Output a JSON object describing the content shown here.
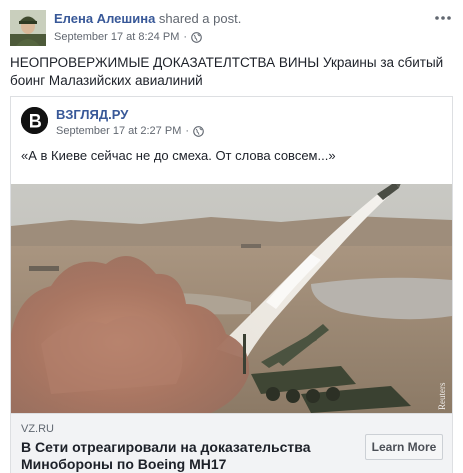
{
  "post": {
    "author_name": "Елена Алешина",
    "action_text": "shared a post.",
    "timestamp": "September 17 at 8:24 PM",
    "separator": "·",
    "privacy_icon": "globe-icon",
    "more_icon": "more-options-icon",
    "text_caps": "НЕОПРОВЕРЖИМЫЕ ДОКАЗАТЕЛТСТВА ВИНЫ",
    "text_rest": " Украины за сбитый боинг Малазийских авиалиний"
  },
  "shared": {
    "page_name": "ВЗГЛЯД.РУ",
    "page_logo": "vzglyad-logo",
    "timestamp": "September 17 at 2:27 PM",
    "separator": "·",
    "privacy_icon": "globe-icon",
    "quote": "«А в Киеве сейчас не до смеха. От слова совсем...»",
    "link": {
      "image_watermark": "Reuters",
      "domain": "VZ.RU",
      "title": "В Сети отреагировали на доказательства Минобороны по Boeing MH17",
      "cta_label": "Learn More"
    }
  },
  "colors": {
    "link_blue": "#385898",
    "meta_gray": "#616770",
    "text": "#1d2129",
    "footer_bg": "#f2f3f5",
    "border": "#dddfe2"
  }
}
